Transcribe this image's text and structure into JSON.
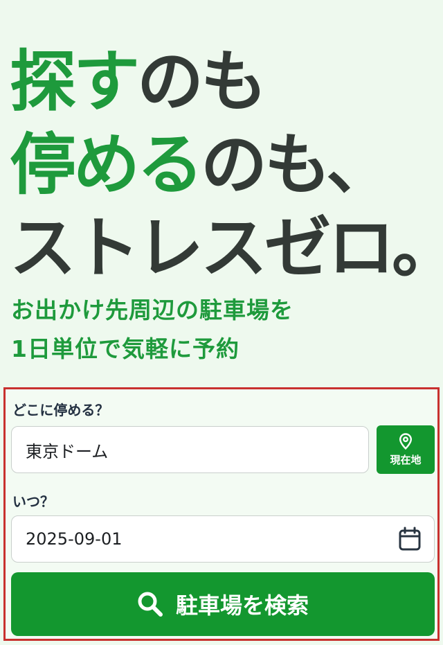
{
  "hero": {
    "line1_green": "探す",
    "line1_dark": "のも",
    "line2_green": "停める",
    "line2_dark": "のも、",
    "line3": "ストレスゼロ。"
  },
  "subtitle": {
    "line1": "お出かけ先周辺の駐車場を",
    "line2": "1日単位で気軽に予約"
  },
  "form": {
    "where_label": "どこに停める？",
    "place_value": "東京ドーム",
    "location_button_label": "現在地",
    "when_label": "いつ？",
    "date_value": "2025-09-01",
    "search_button_label": "駐車場を検索"
  },
  "icons": {
    "location": "map-pin-icon",
    "calendar": "calendar-icon",
    "search": "search-icon"
  },
  "colors": {
    "brand_green": "#1e9a3c",
    "button_green": "#13972f",
    "highlight_border": "#c8302e"
  }
}
